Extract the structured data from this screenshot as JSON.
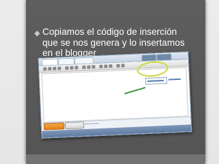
{
  "slide": {
    "bullet": "◆",
    "text": "Copiamos el código de inserción que se nos genera y lo insertamos en el blogger"
  },
  "screenshot": {
    "icon": "blogger-editor-screenshot",
    "accent_color": "#c9d83a",
    "publish_button_color": "#f08c20"
  }
}
